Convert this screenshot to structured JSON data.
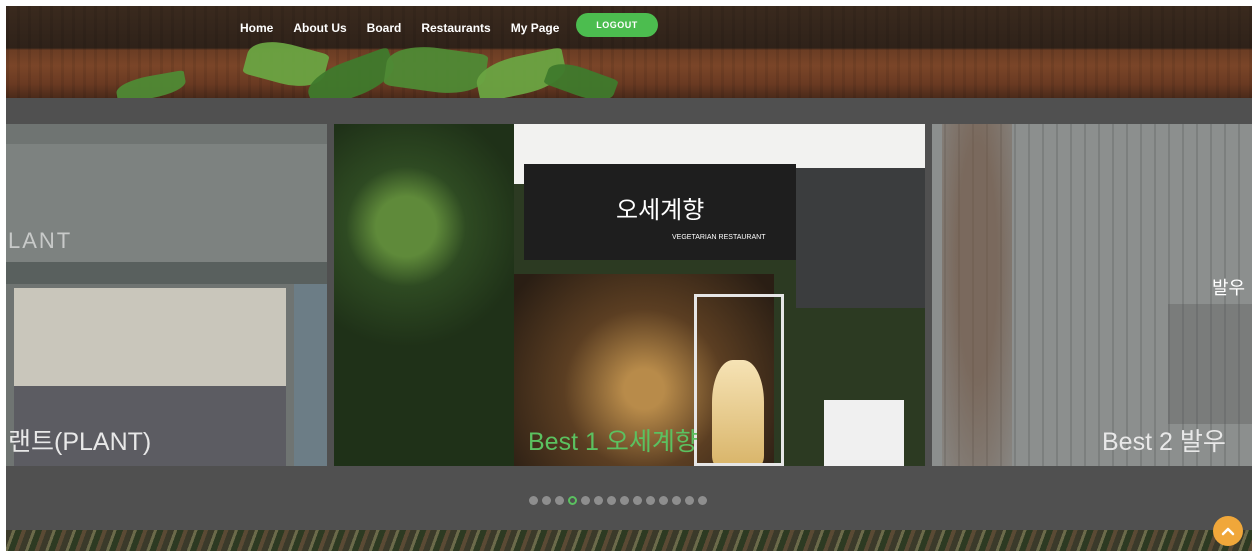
{
  "nav": {
    "items": [
      {
        "label": "Home"
      },
      {
        "label": "About Us"
      },
      {
        "label": "Board"
      },
      {
        "label": "Restaurants"
      },
      {
        "label": "My Page"
      }
    ],
    "logout_label": "LOGOUT"
  },
  "slider": {
    "slides": [
      {
        "caption": "랜트(PLANT)",
        "sign_text": "LANT"
      },
      {
        "caption": "Best 1 오세계향",
        "sign_text": "오세계향",
        "sign_subtext": "VEGETARIAN RESTAURANT"
      },
      {
        "caption": "Best 2 발우",
        "sign_text": "발우"
      }
    ],
    "dot_count": 14,
    "active_dot": 3
  },
  "colors": {
    "accent": "#5bc160",
    "scroll_top": "#f0a73a"
  },
  "icons": {
    "scroll_top": "chevron-up-icon"
  }
}
